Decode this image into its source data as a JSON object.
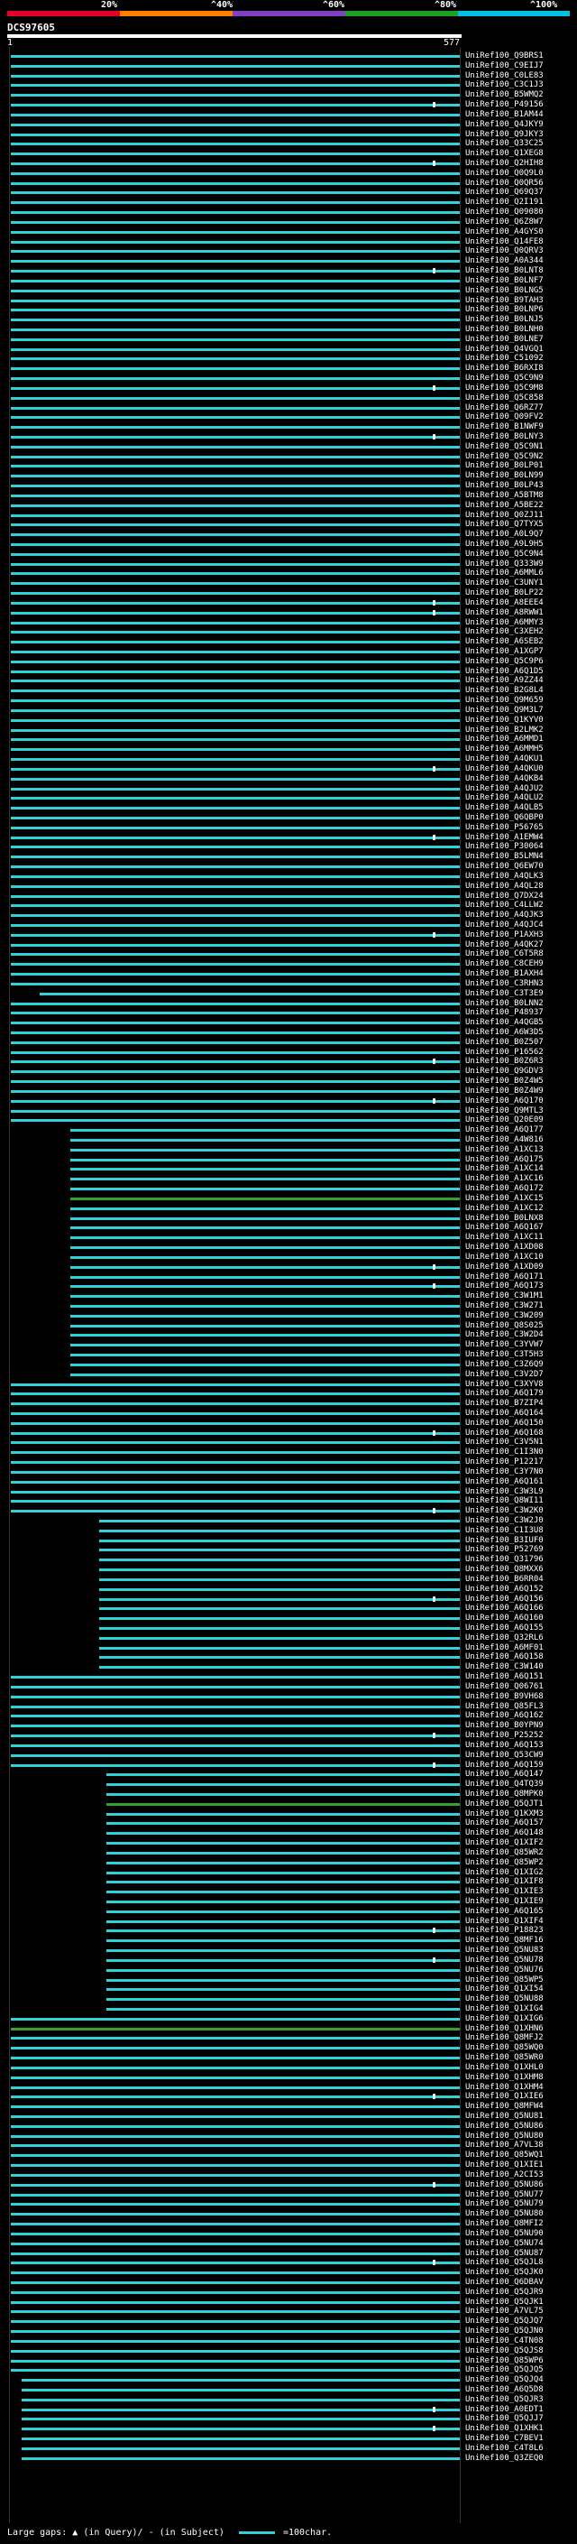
{
  "header": {
    "scale_ticks": [
      "20%",
      "^40%",
      "^60%",
      "^80%",
      "^100%"
    ],
    "scale_colors": [
      "#e4002b",
      "#ff8000",
      "#8040c0",
      "#20a020",
      "#00c0e0"
    ],
    "query_id": "DCS97605",
    "query_start": "1",
    "query_end": "577"
  },
  "hit_color": "#2fd0d6",
  "hits": [
    "UniRef100_Q9BRS1",
    "UniRef100_C9EIJ7",
    "UniRef100_C0LE83",
    "UniRef100_C3C1J3",
    "UniRef100_B5WMQ2",
    "UniRef100_P49156",
    "UniRef100_B1AM44",
    "UniRef100_Q4JKY9",
    "UniRef100_Q9JKY3",
    "UniRef100_Q33C25",
    "UniRef100_Q1XEG8",
    "UniRef100_Q2HIH8",
    "UniRef100_Q0Q9L0",
    "UniRef100_Q0QR56",
    "UniRef100_Q69Q37",
    "UniRef100_Q2I191",
    "UniRef100_Q09080",
    "UniRef100_Q6Z8W7",
    "UniRef100_A4GYS0",
    "UniRef100_Q14FE8",
    "UniRef100_Q0QRV3",
    "UniRef100_A0A344",
    "UniRef100_B0LNT8",
    "UniRef100_B0LNF7",
    "UniRef100_B0LNG5",
    "UniRef100_B9TAH3",
    "UniRef100_B0LNP6",
    "UniRef100_B0LNJ5",
    "UniRef100_B0LNH0",
    "UniRef100_B0LNE7",
    "UniRef100_Q4VGQ1",
    "UniRef100_C51092",
    "UniRef100_B6RXI8",
    "UniRef100_Q5C9N9",
    "UniRef100_Q5C9M8",
    "UniRef100_Q5C858",
    "UniRef100_Q6RZ77",
    "UniRef100_Q09FV2",
    "UniRef100_B1NWF9",
    "UniRef100_B0LNY3",
    "UniRef100_Q5C9N1",
    "UniRef100_Q5C9N2",
    "UniRef100_B0LP01",
    "UniRef100_B0LN99",
    "UniRef100_B0LP43",
    "UniRef100_A5BTM8",
    "UniRef100_A5BE22",
    "UniRef100_Q0ZJ11",
    "UniRef100_Q7TYX5",
    "UniRef100_A0L9Q7",
    "UniRef100_A9L9H5",
    "UniRef100_Q5C9N4",
    "UniRef100_Q333W9",
    "UniRef100_A6MML6",
    "UniRef100_C3UNY1",
    "UniRef100_B0LP22",
    "UniRef100_A8EEE4",
    "UniRef100_A8RWW1",
    "UniRef100_A6MMY3",
    "UniRef100_C3XEH2",
    "UniRef100_A6SEB2",
    "UniRef100_A1XGP7",
    "UniRef100_Q5C9P6",
    "UniRef100_A6Q1D5",
    "UniRef100_A9ZZ44",
    "UniRef100_B2G8L4",
    "UniRef100_Q9M659",
    "UniRef100_Q9M3L7",
    "UniRef100_Q1KYV0",
    "UniRef100_B2LMK2",
    "UniRef100_A6MMD1",
    "UniRef100_A6MMH5",
    "UniRef100_A4QKU1",
    "UniRef100_A4QKU0",
    "UniRef100_A4QKB4",
    "UniRef100_A4QJU2",
    "UniRef100_A4QLU2",
    "UniRef100_A4QLB5",
    "UniRef100_Q6QBP0",
    "UniRef100_P56765",
    "UniRef100_A1EMW4",
    "UniRef100_P30064",
    "UniRef100_B5LMN4",
    "UniRef100_Q6EW70",
    "UniRef100_A4QLK3",
    "UniRef100_A4QL28",
    "UniRef100_Q7DX24",
    "UniRef100_C4LLW2",
    "UniRef100_A4QJK3",
    "UniRef100_A4QJC4",
    "UniRef100_P1AXH3",
    "UniRef100_A4QK27",
    "UniRef100_C6T5R8",
    "UniRef100_C8CEH9",
    "UniRef100_B1AXH4",
    "UniRef100_C3RHN3",
    "UniRef100_C3T3E9",
    "UniRef100_B0LNN2",
    "UniRef100_P48937",
    "UniRef100_A4QGB5",
    "UniRef100_A6W3D5",
    "UniRef100_B0Z507",
    "UniRef100_P16562",
    "UniRef100_B0Z6R3",
    "UniRef100_Q9GDV3",
    "UniRef100_B0Z4W5",
    "UniRef100_B0Z4W9",
    "UniRef100_A6Q170",
    "UniRef100_Q9MTL3",
    "UniRef100_Q20E09",
    "UniRef100_A6Q177",
    "UniRef100_A4W816",
    "UniRef100_A1XC13",
    "UniRef100_A6Q175",
    "UniRef100_A1XC14",
    "UniRef100_A1XC16",
    "UniRef100_A6Q172",
    "UniRef100_A1XC15",
    "UniRef100_A1XC12",
    "UniRef100_B0LNX8",
    "UniRef100_A6Q167",
    "UniRef100_A1XC11",
    "UniRef100_A1XD08",
    "UniRef100_A1XC10",
    "UniRef100_A1XD09",
    "UniRef100_A6Q171",
    "UniRef100_A6Q173",
    "UniRef100_C3W1M1",
    "UniRef100_C3W271",
    "UniRef100_C3W209",
    "UniRef100_Q8S025",
    "UniRef100_C3W2D4",
    "UniRef100_C3YVW7",
    "UniRef100_C3T5H3",
    "UniRef100_C3Z6Q9",
    "UniRef100_C3V2D7",
    "UniRef100_C3XYV8",
    "UniRef100_A6Q179",
    "UniRef100_B7ZIP4",
    "UniRef100_A6Q164",
    "UniRef100_A6Q150",
    "UniRef100_A6Q168",
    "UniRef100_C3V5N1",
    "UniRef100_C1I3N0",
    "UniRef100_P12217",
    "UniRef100_C3Y7N0",
    "UniRef100_A6Q161",
    "UniRef100_C3W3L9",
    "UniRef100_Q8WI11",
    "UniRef100_C3W2K0",
    "UniRef100_C3W2J0",
    "UniRef100_C1I3U8",
    "UniRef100_B3IUF0",
    "UniRef100_P52769",
    "UniRef100_Q31796",
    "UniRef100_Q8MXX6",
    "UniRef100_B6RR04",
    "UniRef100_A6Q152",
    "UniRef100_A6Q156",
    "UniRef100_A6Q166",
    "UniRef100_A6Q160",
    "UniRef100_A6Q155",
    "UniRef100_Q32RL6",
    "UniRef100_A6MF01",
    "UniRef100_A6Q158",
    "UniRef100_C3W140",
    "UniRef100_A6Q151",
    "UniRef100_Q06761",
    "UniRef100_B9VH68",
    "UniRef100_Q85FL3",
    "UniRef100_A6Q162",
    "UniRef100_B0YPN9",
    "UniRef100_P25252",
    "UniRef100_A6Q153",
    "UniRef100_Q53CW9",
    "UniRef100_A6Q159",
    "UniRef100_A6Q147",
    "UniRef100_Q4TQ39",
    "UniRef100_Q8MPK0",
    "UniRef100_Q5QJT1",
    "UniRef100_Q1KXM3",
    "UniRef100_A6Q157",
    "UniRef100_A6Q148",
    "UniRef100_Q1XIF2",
    "UniRef100_Q85WR2",
    "UniRef100_Q85WP2",
    "UniRef100_Q1XIG2",
    "UniRef100_Q1XIF8",
    "UniRef100_Q1XIE3",
    "UniRef100_Q1XIE9",
    "UniRef100_A6Q165",
    "UniRef100_Q1XIF4",
    "UniRef100_P18823",
    "UniRef100_Q8MF16",
    "UniRef100_Q5NU83",
    "UniRef100_Q5NU78",
    "UniRef100_Q5NU76",
    "UniRef100_Q85WP5",
    "UniRef100_Q1XI54",
    "UniRef100_Q5NU88",
    "UniRef100_Q1XIG4",
    "UniRef100_Q1XIG6",
    "UniRef100_Q1XHN6",
    "UniRef100_Q8MFJ2",
    "UniRef100_Q85WQ0",
    "UniRef100_Q85WR0",
    "UniRef100_Q1XHL0",
    "UniRef100_Q1XHM8",
    "UniRef100_Q1XHM4",
    "UniRef100_Q1XIE6",
    "UniRef100_Q8MFW4",
    "UniRef100_Q5NU81",
    "UniRef100_Q5NU86",
    "UniRef100_Q5NU80",
    "UniRef100_A7VL38",
    "UniRef100_Q85WQ1",
    "UniRef100_Q1XIE1",
    "UniRef100_A2CI53",
    "UniRef100_Q5NU86",
    "UniRef100_Q5NU77",
    "UniRef100_Q5NU79",
    "UniRef100_Q5NU80",
    "UniRef100_Q8MFI2",
    "UniRef100_Q5NU90",
    "UniRef100_Q5NU74",
    "UniRef100_Q5NU87",
    "UniRef100_Q5QJL8",
    "UniRef100_Q5QJK0",
    "UniRef100_Q6DBAV",
    "UniRef100_Q5QJR9",
    "UniRef100_Q5QJK1",
    "UniRef100_A7VL75",
    "UniRef100_Q5QJQ7",
    "UniRef100_Q5QJN0",
    "UniRef100_C4TN08",
    "UniRef100_Q5QJS8",
    "UniRef100_Q85WP6",
    "UniRef100_Q5QJQ5",
    "UniRef100_Q5QJQ4",
    "UniRef100_A6Q5D8",
    "UniRef100_Q5QJR3",
    "UniRef100_A0EDT1",
    "UniRef100_Q5QJJ7",
    "UniRef100_Q1XHK1",
    "UniRef100_C7BEV1",
    "UniRef100_C4T8L6",
    "UniRef100_Q3ZEQ0"
  ],
  "legend": {
    "large_gaps_label": "Large gaps:",
    "in_query_label": "(in Query)/",
    "in_subject_label": "- (in Subject)",
    "scale_label": "=100char."
  }
}
